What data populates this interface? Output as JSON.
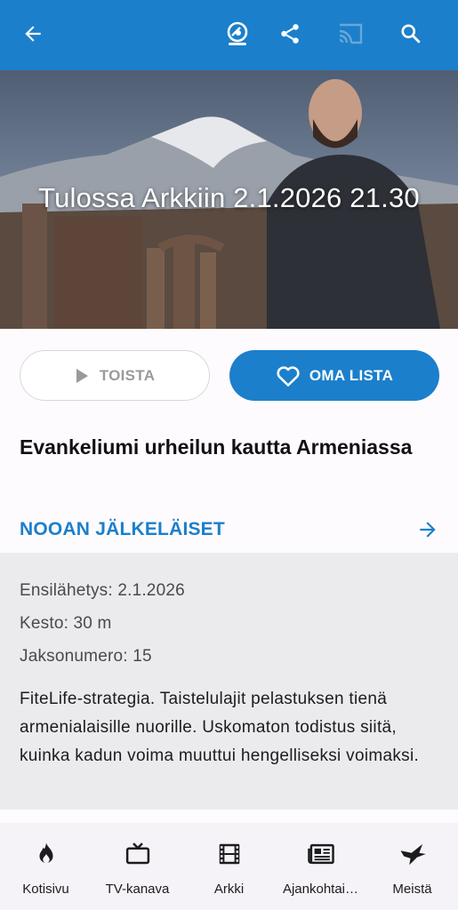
{
  "topbar": {
    "background": "#1b7fcb",
    "icons": [
      "back-arrow-icon",
      "live-badge-icon",
      "share-icon",
      "cast-icon",
      "search-icon"
    ]
  },
  "hero": {
    "overlay_text": "Tulossa Arkkiin 2.1.2026 21.30"
  },
  "actions": {
    "play_label": "TOISTA",
    "my_list_label": "OMA LISTA"
  },
  "episode": {
    "title": "Evankeliumi urheilun kautta Armeniassa",
    "series_label": "NOOAN JÄLKELÄISET"
  },
  "details": {
    "premiere": "Ensilähetys: 2.1.2026",
    "duration": "Kesto: 30 m",
    "episode_number": "Jaksonumero: 15",
    "description": "FiteLife-strategia. Taistelulajit pelastuksen tienä armenialaisille nuorille. Uskomaton todistus siitä, kuinka kadun voima muuttui hengelliseksi voimaksi."
  },
  "bottom_nav": {
    "items": [
      {
        "label": "Kotisivu",
        "icon": "flame-icon"
      },
      {
        "label": "TV-kanava",
        "icon": "tv-icon"
      },
      {
        "label": "Arkki",
        "icon": "film-icon"
      },
      {
        "label": "Ajankohtai…",
        "icon": "newspaper-icon"
      },
      {
        "label": "Meistä",
        "icon": "dove-icon"
      }
    ]
  },
  "colors": {
    "accent": "#1b7fcb",
    "details_bg": "#ebebed",
    "nav_bg": "#f5f3f7"
  }
}
